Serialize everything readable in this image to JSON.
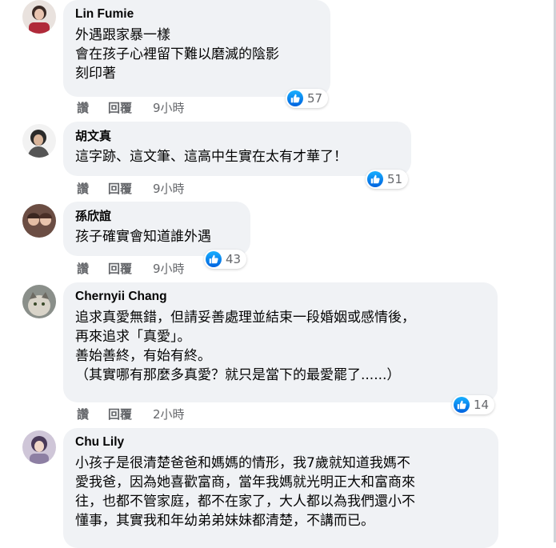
{
  "comments": [
    {
      "author": "Lin Fumie",
      "lines": [
        "外遇跟家暴一樣",
        "會在孩子心裡留下難以磨滅的陰影",
        "刻印著"
      ],
      "like_label": "讚",
      "reply_label": "回覆",
      "time": "9小時",
      "reaction_count": "57"
    },
    {
      "author": "胡文真",
      "lines": [
        "這字跡、這文筆、這高中生實在太有才華了！"
      ],
      "like_label": "讚",
      "reply_label": "回覆",
      "time": "9小時",
      "reaction_count": "51"
    },
    {
      "author": "孫欣誼",
      "lines": [
        "孩子確實會知道誰外遇"
      ],
      "like_label": "讚",
      "reply_label": "回覆",
      "time": "9小時",
      "reaction_count": "43"
    },
    {
      "author": "Chernyii Chang",
      "lines": [
        "追求真愛無錯，但請妥善處理並結束一段婚姻或感情後，",
        "再來追求「真愛」。",
        "善始善終，有始有終。",
        "（其實哪有那麼多真愛？就只是當下的最愛罷了......）"
      ],
      "like_label": "讚",
      "reply_label": "回覆",
      "time": "2小時",
      "reaction_count": "14"
    },
    {
      "author": "Chu Lily",
      "lines": [
        "小孩子是很清楚爸爸和媽媽的情形，我7歲就知道我媽不",
        "愛我爸，因為她喜歡富商，當年我媽就光明正大和富商來",
        "往，也都不管家庭，都不在家了，大人都以為我們還小不",
        "懂事，其實我和年幼弟弟妹妹都清楚，不講而已。"
      ]
    }
  ],
  "colors": {
    "bubble": "#f0f2f5",
    "text": "#050505",
    "meta": "#65676b",
    "like_blue": "#0866ff"
  },
  "icons": [
    "thumbs-up-icon"
  ]
}
